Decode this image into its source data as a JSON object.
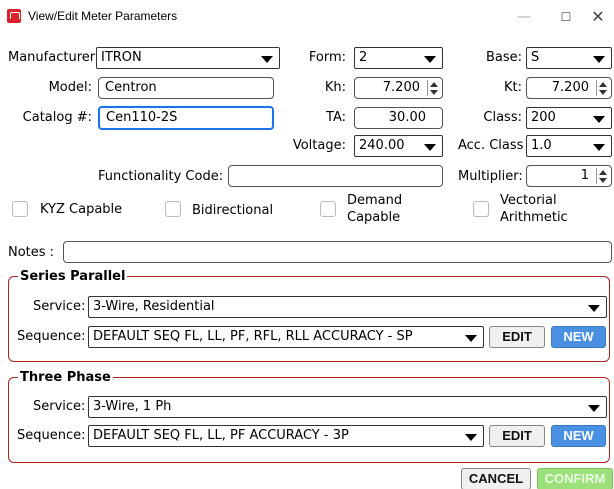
{
  "window": {
    "title": "View/Edit Meter Parameters",
    "min": "—",
    "max": "☐",
    "close": "✕"
  },
  "fields": {
    "manufacturer": {
      "label": "Manufacturer:",
      "value": "ITRON"
    },
    "model": {
      "label": "Model:",
      "value": "Centron"
    },
    "catalog": {
      "label": "Catalog #:",
      "value": "Cen110-2S"
    },
    "form": {
      "label": "Form:",
      "value": "2"
    },
    "kh": {
      "label": "Kh:",
      "value": "7.200"
    },
    "ta": {
      "label": "TA:",
      "value": "30.00"
    },
    "voltage": {
      "label": "Voltage:",
      "value": "240.00"
    },
    "base": {
      "label": "Base:",
      "value": "S"
    },
    "kt": {
      "label": "Kt:",
      "value": "7.200"
    },
    "class": {
      "label": "Class:",
      "value": "200"
    },
    "acc_class": {
      "label": "Acc. Class",
      "value": "1.0"
    },
    "multiplier": {
      "label": "Multiplier:",
      "value": "1"
    },
    "functionality_code": {
      "label": "Functionality Code:",
      "value": ""
    },
    "notes": {
      "label": "Notes :",
      "value": ""
    }
  },
  "checkboxes": {
    "kyz": "KYZ Capable",
    "bidirectional": "Bidirectional",
    "demand_1": "Demand",
    "demand_2": "Capable",
    "vectorial_1": "Vectorial",
    "vectorial_2": "Arithmetic"
  },
  "series_parallel": {
    "title": "Series Parallel",
    "service_label": "Service:",
    "service_value": "3-Wire, Residential",
    "sequence_label": "Sequence:",
    "sequence_value": "DEFAULT SEQ FL, LL, PF, RFL, RLL ACCURACY - SP",
    "edit": "EDIT",
    "new": "NEW"
  },
  "three_phase": {
    "title": "Three Phase",
    "service_label": "Service:",
    "service_value": "3-Wire, 1 Ph",
    "sequence_label": "Sequence:",
    "sequence_value": "DEFAULT SEQ FL, LL, PF ACCURACY - 3P",
    "edit": "EDIT",
    "new": "NEW"
  },
  "footer": {
    "cancel": "CANCEL",
    "confirm": "CONFIRM"
  },
  "colors": {
    "group_border": "#b22222",
    "new_button": "#4a90e2",
    "confirm_button": "#9be07a",
    "focus": "#1a73e8"
  }
}
